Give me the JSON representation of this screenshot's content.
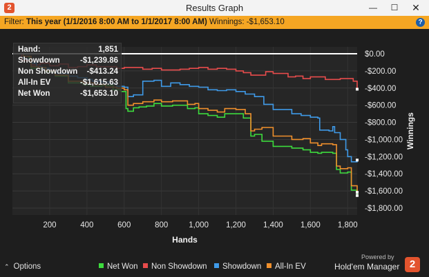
{
  "window": {
    "title": "Results Graph",
    "app_icon": "2"
  },
  "filter": {
    "label": "Filter:",
    "range": "This year (1/1/2016 8:00 AM to 1/1/2017 8:00 AM)",
    "winnings_label": "Winnings:",
    "winnings_value": "-$1,653.10"
  },
  "tooltip": [
    {
      "key": "Hand:",
      "value": "1,851"
    },
    {
      "key": "Showdown",
      "value": "-$1,239.86"
    },
    {
      "key": "Non Showdown",
      "value": "-$413.24"
    },
    {
      "key": "All-In EV",
      "value": "-$1,615.63"
    },
    {
      "key": "Net Won",
      "value": "-$1,653.10"
    }
  ],
  "footer": {
    "options_label": "Options",
    "powered_by": "Powered by",
    "brand": "Hold'em Manager",
    "brand_logo": "2"
  },
  "legend": [
    {
      "name": "Net Won",
      "color": "#3ddc3d"
    },
    {
      "name": "Non Showdown",
      "color": "#e84c4c"
    },
    {
      "name": "Showdown",
      "color": "#3f9ae8"
    },
    {
      "name": "All-In EV",
      "color": "#f0902c"
    }
  ],
  "colors": {
    "filter_bar": "#f5a623",
    "background": "#1e1e1e",
    "zero_line": "#ffffff"
  },
  "chart_data": {
    "type": "line",
    "xlabel": "Hands",
    "ylabel": "Winnings",
    "xlim": [
      0,
      1851
    ],
    "ylim": [
      -1800,
      0
    ],
    "xticks": [
      200,
      400,
      600,
      800,
      1000,
      1200,
      1400,
      1600,
      1800
    ],
    "xtick_labels": [
      "200",
      "400",
      "600",
      "800",
      "1,000",
      "1,200",
      "1,400",
      "1,600",
      "1,800"
    ],
    "yticks": [
      0,
      -200,
      -400,
      -600,
      -800,
      -1000,
      -1200,
      -1400,
      -1600,
      -1800
    ],
    "ytick_labels": [
      "$0.00",
      "-$200.00",
      "-$400.00",
      "-$600.00",
      "-$800.00",
      "-$1,000.00",
      "-$1,200.00",
      "-$1,400.00",
      "-$1,600.00",
      "-$1,800.00"
    ],
    "grid": true,
    "legend_position": "bottom",
    "series": [
      {
        "name": "Net Won",
        "color": "#3ddc3d",
        "x": [
          0,
          60,
          90,
          100,
          140,
          180,
          230,
          300,
          380,
          420,
          480,
          540,
          580,
          610,
          620,
          650,
          680,
          720,
          760,
          800,
          860,
          940,
          980,
          1000,
          1050,
          1100,
          1140,
          1200,
          1240,
          1280,
          1300,
          1340,
          1400,
          1500,
          1560,
          1600,
          1640,
          1660,
          1720,
          1740,
          1760,
          1800,
          1820,
          1851
        ],
        "y": [
          0,
          -30,
          -90,
          -170,
          -170,
          -210,
          -260,
          -340,
          -360,
          -380,
          -370,
          -420,
          -440,
          -640,
          -670,
          -630,
          -620,
          -610,
          -580,
          -610,
          -600,
          -640,
          -630,
          -700,
          -720,
          -740,
          -700,
          -700,
          -750,
          -960,
          -940,
          -1020,
          -1080,
          -1100,
          -1120,
          -1150,
          -1160,
          -1150,
          -1160,
          -1350,
          -1390,
          -1380,
          -1590,
          -1653.1
        ]
      },
      {
        "name": "Non Showdown",
        "color": "#e84c4c",
        "x": [
          0,
          50,
          100,
          150,
          200,
          250,
          300,
          350,
          400,
          450,
          500,
          560,
          600,
          650,
          700,
          750,
          800,
          850,
          900,
          950,
          1000,
          1050,
          1100,
          1150,
          1200,
          1240,
          1280,
          1300,
          1360,
          1400,
          1440,
          1480,
          1520,
          1560,
          1600,
          1640,
          1680,
          1720,
          1760,
          1800,
          1830,
          1851
        ],
        "y": [
          0,
          -80,
          -130,
          -110,
          -140,
          -120,
          -160,
          -150,
          -130,
          -150,
          -150,
          -170,
          -160,
          -160,
          -180,
          -170,
          -190,
          -190,
          -180,
          -170,
          -160,
          -180,
          -170,
          -180,
          -200,
          -220,
          -250,
          -250,
          -210,
          -230,
          -230,
          -270,
          -260,
          -290,
          -270,
          -270,
          -300,
          -300,
          -290,
          -290,
          -320,
          -413.24
        ]
      },
      {
        "name": "Showdown",
        "color": "#3f9ae8",
        "x": [
          0,
          60,
          100,
          130,
          160,
          200,
          240,
          300,
          350,
          400,
          430,
          480,
          520,
          560,
          600,
          620,
          650,
          700,
          760,
          800,
          850,
          900,
          950,
          1000,
          1050,
          1100,
          1150,
          1200,
          1250,
          1300,
          1350,
          1400,
          1500,
          1550,
          1600,
          1640,
          1650,
          1700,
          1720,
          1730,
          1760,
          1790,
          1800,
          1820,
          1851
        ],
        "y": [
          0,
          -60,
          -110,
          -150,
          -170,
          -200,
          -230,
          -260,
          -280,
          -300,
          -320,
          -330,
          -350,
          -380,
          -390,
          -500,
          -480,
          -320,
          -310,
          -380,
          -340,
          -360,
          -380,
          -390,
          -420,
          -430,
          -420,
          -440,
          -470,
          -500,
          -590,
          -650,
          -700,
          -720,
          -740,
          -750,
          -890,
          -900,
          -850,
          -920,
          -1000,
          -1120,
          -1200,
          -1260,
          -1239.86
        ]
      },
      {
        "name": "All-In EV",
        "color": "#f0902c",
        "x": [
          0,
          60,
          100,
          140,
          180,
          230,
          300,
          380,
          440,
          500,
          560,
          600,
          620,
          650,
          700,
          760,
          800,
          860,
          940,
          980,
          1000,
          1050,
          1100,
          1140,
          1200,
          1250,
          1280,
          1300,
          1340,
          1400,
          1500,
          1560,
          1600,
          1640,
          1660,
          1720,
          1740,
          1760,
          1800,
          1820,
          1851
        ],
        "y": [
          0,
          -30,
          -150,
          -160,
          -200,
          -250,
          -320,
          -340,
          -360,
          -390,
          -400,
          -420,
          -600,
          -580,
          -560,
          -540,
          -560,
          -550,
          -590,
          -580,
          -640,
          -660,
          -680,
          -640,
          -650,
          -700,
          -900,
          -880,
          -860,
          -960,
          -1000,
          -990,
          -1040,
          -1070,
          -1050,
          -1060,
          -1310,
          -1340,
          -1330,
          -1540,
          -1615.63
        ]
      }
    ]
  }
}
